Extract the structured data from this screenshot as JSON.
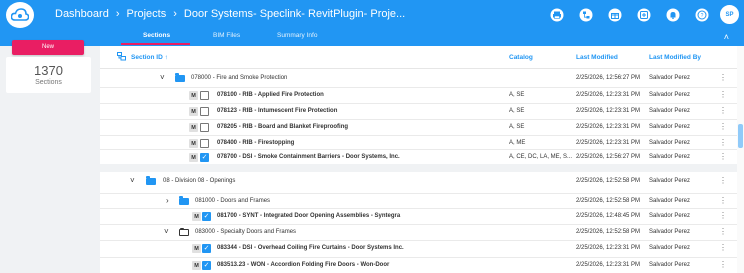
{
  "header": {
    "breadcrumbs": [
      "Dashboard",
      "Projects",
      "Door Systems- Speclink- RevitPlugin- Proje..."
    ],
    "breadcrumb_separator": "›",
    "icons": [
      "print-icon",
      "hierarchy-icon",
      "gift-icon",
      "help-center-icon",
      "bell-icon",
      "help-icon"
    ],
    "avatar_initials": "SP"
  },
  "tabs": [
    {
      "label": "Sections",
      "active": true
    },
    {
      "label": "BIM Files",
      "active": false
    },
    {
      "label": "Summary Info",
      "active": false
    }
  ],
  "collapse_glyph": "˄",
  "sidebar": {
    "new_label": "New",
    "count": "1370",
    "count_label": "Sections"
  },
  "table": {
    "columns": {
      "section_id": "Section ID",
      "sort_indicator": "↑",
      "catalog": "Catalog",
      "last_modified": "Last Modified",
      "last_modified_by": "Last Modified By"
    },
    "rows": [
      {
        "name": "078000 - Fire and Smoke Protection",
        "catalog": "",
        "modified": "2/25/2026, 12:56:27 PM",
        "by": "Salvador Perez"
      },
      {
        "m": "M",
        "checked": false,
        "name": "078100 - RIB - Applied Fire Protection",
        "catalog": "A, SE",
        "modified": "2/25/2026, 12:23:31 PM",
        "by": "Salvador Perez"
      },
      {
        "m": "M",
        "checked": false,
        "name": "078123 - RIB - Intumescent Fire Protection",
        "catalog": "A, SE",
        "modified": "2/25/2026, 12:23:31 PM",
        "by": "Salvador Perez"
      },
      {
        "m": "M",
        "checked": false,
        "name": "078205 - RIB - Board and Blanket Fireproofing",
        "catalog": "A, SE",
        "modified": "2/25/2026, 12:23:31 PM",
        "by": "Salvador Perez"
      },
      {
        "m": "M",
        "checked": false,
        "name": "078400 - RIB - Firestopping",
        "catalog": "A, ME",
        "modified": "2/25/2026, 12:23:31 PM",
        "by": "Salvador Perez"
      },
      {
        "m": "M",
        "checked": true,
        "name": "078700 - DSI - Smoke Containment Barriers - Door Systems, Inc.",
        "catalog": "A, CE, DC, LA, ME, S...",
        "modified": "2/25/2026, 12:56:27 PM",
        "by": "Salvador Perez"
      },
      {
        "name": "08 - Division 08 - Openings",
        "catalog": "",
        "modified": "2/25/2026, 12:52:58 PM",
        "by": "Salvador Perez"
      },
      {
        "name": "081000 - Doors and Frames",
        "catalog": "",
        "modified": "2/25/2026, 12:52:58 PM",
        "by": "Salvador Perez"
      },
      {
        "m": "M",
        "checked": true,
        "name": "081700 - SYNT - Integrated Door Opening Assemblies - Syntegra",
        "catalog": "",
        "modified": "2/25/2026, 12:48:45 PM",
        "by": "Salvador Perez"
      },
      {
        "name": "083000 - Specialty Doors and Frames",
        "catalog": "",
        "modified": "2/25/2026, 12:52:58 PM",
        "by": "Salvador Perez"
      },
      {
        "m": "M",
        "checked": true,
        "name": "083344 - DSI - Overhead Coiling Fire Curtains - Door Systems Inc.",
        "catalog": "",
        "modified": "2/25/2026, 12:23:31 PM",
        "by": "Salvador Perez"
      },
      {
        "m": "M",
        "checked": true,
        "name": "083513.23 - WON - Accordion Folding Fire Doors - Won-Door",
        "catalog": "",
        "modified": "2/25/2026, 12:23:31 PM",
        "by": "Salvador Perez"
      }
    ],
    "expand_open": "˅",
    "expand_closed": "›",
    "kebab": "⋮"
  }
}
